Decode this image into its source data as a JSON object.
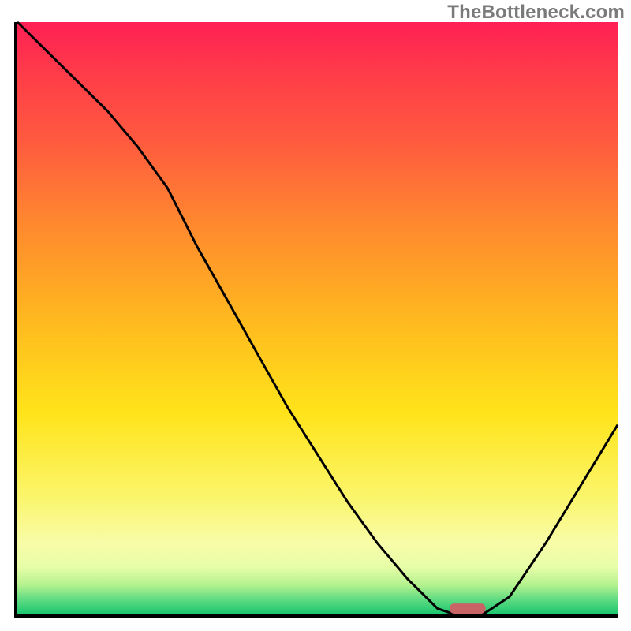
{
  "watermark": "TheBottleneck.com",
  "chart_data": {
    "type": "line",
    "title": "",
    "xlabel": "",
    "ylabel": "",
    "xlim": [
      0,
      100
    ],
    "ylim": [
      0,
      100
    ],
    "x": [
      0,
      5,
      10,
      15,
      20,
      25,
      30,
      35,
      40,
      45,
      50,
      55,
      60,
      65,
      70,
      72,
      75,
      78,
      82,
      88,
      94,
      100
    ],
    "values": [
      100,
      95,
      90,
      85,
      79,
      72,
      62,
      53,
      44,
      35,
      27,
      19,
      12,
      6,
      1,
      0.3,
      0.3,
      0.3,
      3,
      12,
      22,
      32
    ],
    "grid": false,
    "legend": false,
    "sweet_spot_x_range": [
      72,
      78
    ],
    "sweet_spot_color": "#c86466",
    "background_gradient": {
      "top": "#ff1f54",
      "mid": "#ffe41a",
      "bottom": "#18c66f"
    }
  }
}
